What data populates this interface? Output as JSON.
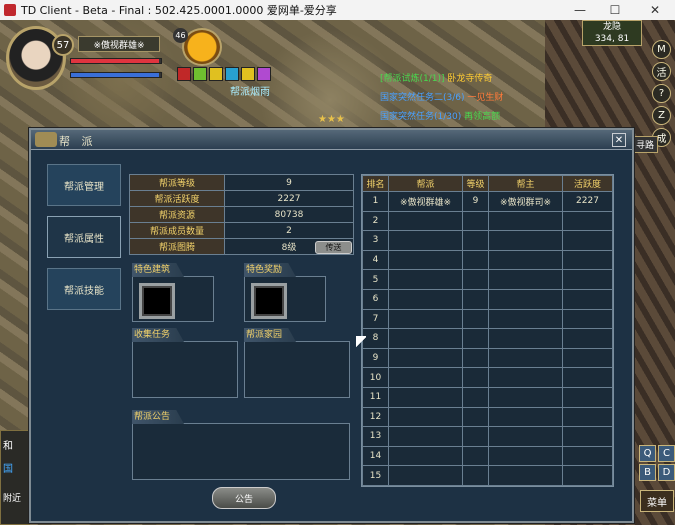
{
  "window": {
    "title": "TD Client - Beta - Final : 502.425.0001.0000 爱网单-爱分享",
    "minimize": "—",
    "maximize": "☐",
    "close": "✕"
  },
  "player": {
    "level": "57",
    "name": "※傲视群雄※",
    "hp_fill": 0.98,
    "mp_fill": 0.98
  },
  "pet": {
    "level": "46"
  },
  "guild_tag": "帮派烟雨",
  "quests": [
    {
      "text": "[帮派试炼(1/1)]",
      "suffix": " 卧龙寺传奇",
      "color1": "#49d94f",
      "color2": "#ffcc33"
    },
    {
      "text": "国家突然任务二(3/6)",
      "suffix": " 一见生财",
      "color1": "#49a0ff",
      "color2": "#ff7a3a"
    },
    {
      "text": "国家突然任务(1/30)",
      "suffix": " 再领高额",
      "color1": "#49a0ff",
      "color2": "#49d94f"
    }
  ],
  "minimap": {
    "name": "龙隐",
    "coords": "334, 81"
  },
  "side_buttons": [
    "M",
    "活",
    "?",
    "Z",
    "成"
  ],
  "find_road": "寻路",
  "bottom_buttons": [
    "Q",
    "C",
    "B",
    "D"
  ],
  "menu_button": "菜单",
  "left_edge": [
    "和",
    "国",
    "附近"
  ],
  "dialog": {
    "title": "帮 派",
    "close": "✕",
    "tabs": [
      "帮派管理",
      "帮派属性",
      "帮派技能"
    ],
    "active_tab": 1,
    "info": [
      {
        "key": "帮派等级",
        "value": "9"
      },
      {
        "key": "帮派活跃度",
        "value": "2227"
      },
      {
        "key": "帮派资源",
        "value": "80738"
      },
      {
        "key": "帮派成员数量",
        "value": "2"
      },
      {
        "key": "帮派图腾",
        "value": "8级"
      }
    ],
    "transfer_button": "传送",
    "sections": {
      "special_building": "特色建筑",
      "special_reward": "特色奖励",
      "collect_task": "收集任务",
      "guild_home": "帮派家园",
      "announcement": "帮派公告"
    },
    "notice_button": "公告",
    "rank": {
      "headers": [
        "排名",
        "帮派",
        "等级",
        "帮主",
        "活跃度"
      ],
      "rows": [
        [
          "1",
          "※傲视群雄※",
          "9",
          "※傲视群司※",
          "2227"
        ],
        [
          "2",
          "",
          "",
          "",
          ""
        ],
        [
          "3",
          "",
          "",
          "",
          ""
        ],
        [
          "4",
          "",
          "",
          "",
          ""
        ],
        [
          "5",
          "",
          "",
          "",
          ""
        ],
        [
          "6",
          "",
          "",
          "",
          ""
        ],
        [
          "7",
          "",
          "",
          "",
          ""
        ],
        [
          "8",
          "",
          "",
          "",
          ""
        ],
        [
          "9",
          "",
          "",
          "",
          ""
        ],
        [
          "10",
          "",
          "",
          "",
          ""
        ],
        [
          "11",
          "",
          "",
          "",
          ""
        ],
        [
          "12",
          "",
          "",
          "",
          ""
        ],
        [
          "13",
          "",
          "",
          "",
          ""
        ],
        [
          "14",
          "",
          "",
          "",
          ""
        ],
        [
          "15",
          "",
          "",
          "",
          ""
        ]
      ]
    }
  },
  "colors": {
    "hp": "#e0343f",
    "mp": "#3a6fd8",
    "accent": "#f3d36b"
  }
}
